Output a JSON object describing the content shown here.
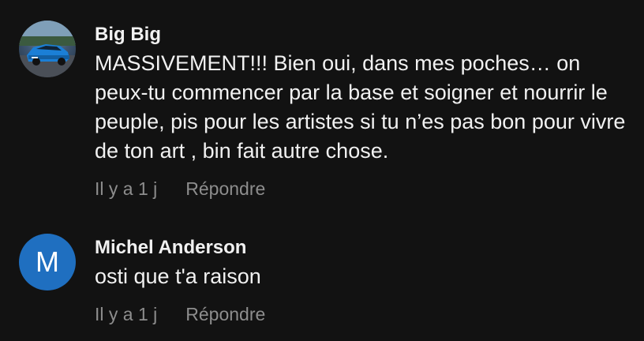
{
  "comments": [
    {
      "author": "Big Big",
      "avatar": {
        "type": "photo",
        "icon": "car-photo-avatar"
      },
      "text": "MASSIVEMENT!!! Bien oui, dans mes poches… on peux-tu commencer par la base et soigner et nourrir le peuple, pis pour les artistes si tu n’es pas bon pour vivre de ton art , bin fait autre chose.",
      "time": "Il y a 1 j",
      "reply_label": "Répondre"
    },
    {
      "author": "Michel Anderson",
      "avatar": {
        "type": "letter",
        "letter": "M",
        "color": "#1f6fc0"
      },
      "text": "osti que t'a raison",
      "time": "Il y a 1 j",
      "reply_label": "Répondre"
    }
  ]
}
